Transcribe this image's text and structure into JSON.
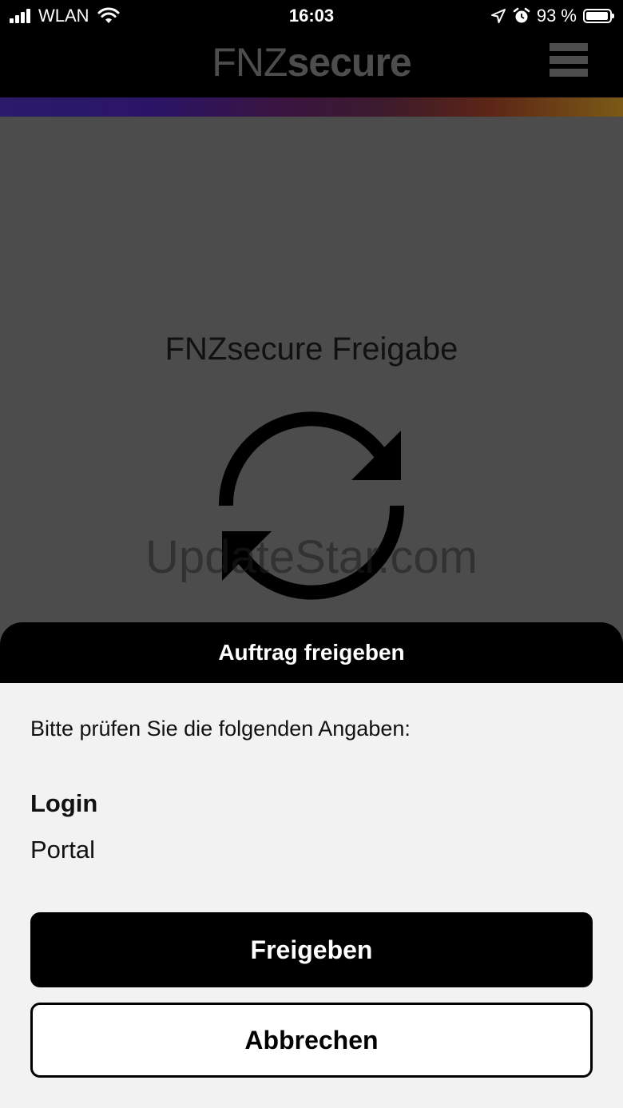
{
  "status_bar": {
    "carrier": "WLAN",
    "time": "16:03",
    "battery": "93 %",
    "battery_level_percent": 93,
    "icons": [
      "signal-icon",
      "wifi-icon",
      "location-arrow-icon",
      "alarm-icon",
      "battery-icon"
    ]
  },
  "header": {
    "logo_part_1": "FNZ",
    "logo_part_2": "secure",
    "menu_icon": "hamburger-menu-icon"
  },
  "main": {
    "title": "FNZsecure Freigabe",
    "icon": "sync-icon",
    "watermark": "UpdateStar.com"
  },
  "sheet": {
    "title": "Auftrag freigeben",
    "instructions": "Bitte prüfen Sie die folgenden Angaben:",
    "detail_label": "Login",
    "detail_value": "Portal",
    "primary_button": "Freigeben",
    "secondary_button": "Abbrechen"
  },
  "colors": {
    "header_bg": "#000000",
    "overlay_bg": "#4c4c4c",
    "sheet_bg": "#f2f2f2",
    "logo": "#4d4d4d",
    "primary_button_bg": "#000000",
    "secondary_button_bg": "#ffffff"
  }
}
